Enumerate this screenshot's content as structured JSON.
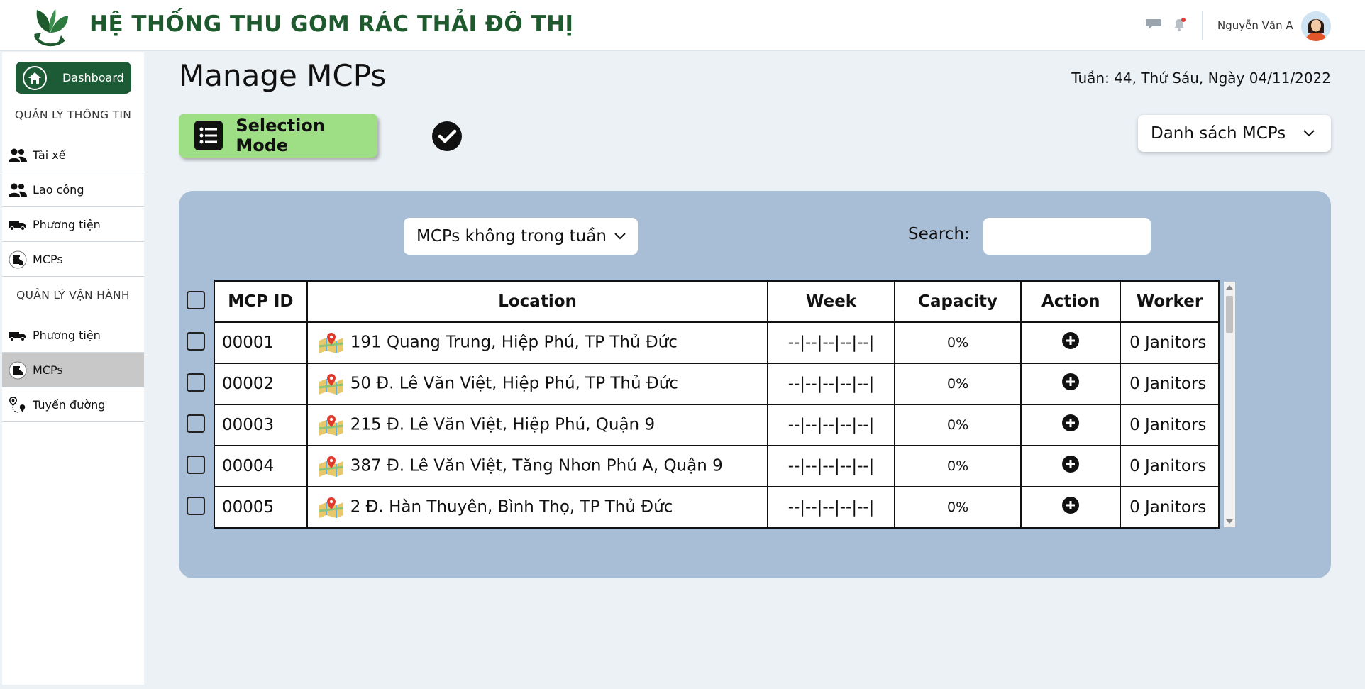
{
  "header": {
    "app_title": "HỆ THỐNG THU GOM RÁC THẢI ĐÔ THỊ",
    "user_name": "Nguyễn Văn A"
  },
  "sidebar": {
    "dashboard_label": "Dashboard",
    "section_info": "QUẢN LÝ THÔNG TIN",
    "info_items": [
      {
        "label": "Tài xế",
        "icon": "users-icon"
      },
      {
        "label": "Lao công",
        "icon": "users-icon"
      },
      {
        "label": "Phương tiện",
        "icon": "truck-icon"
      },
      {
        "label": "MCPs",
        "icon": "bin-icon"
      }
    ],
    "section_ops": "QUẢN LÝ VẬN HÀNH",
    "ops_items": [
      {
        "label": "Phương tiện",
        "icon": "truck-icon"
      },
      {
        "label": "MCPs",
        "icon": "bin-icon",
        "active": true
      },
      {
        "label": "Tuyến đường",
        "icon": "route-icon"
      }
    ]
  },
  "main": {
    "page_title": "Manage MCPs",
    "date_text": "Tuần: 44, Thứ Sáu, Ngày 04/11/2022",
    "selection_mode_label": "Selection Mode",
    "list_dropdown_label": "Danh sách MCPs",
    "filter_dropdown_label": "MCPs không trong tuần",
    "search_label": "Search:",
    "search_value": ""
  },
  "table": {
    "headers": [
      "MCP ID",
      "Location",
      "Week",
      "Capacity",
      "Action",
      "Worker"
    ],
    "rows": [
      {
        "id": "00001",
        "location": "191 Quang Trung, Hiệp Phú, TP Thủ Đức",
        "week": "--|--|--|--|--|",
        "capacity": "0%",
        "worker": "0 Janitors"
      },
      {
        "id": "00002",
        "location": "50 Đ. Lê Văn Việt, Hiệp Phú, TP Thủ Đức",
        "week": "--|--|--|--|--|",
        "capacity": "0%",
        "worker": "0 Janitors"
      },
      {
        "id": "00003",
        "location": "215 Đ. Lê Văn Việt, Hiệp Phú, Quận 9",
        "week": "--|--|--|--|--|",
        "capacity": "0%",
        "worker": "0 Janitors"
      },
      {
        "id": "00004",
        "location": "387 Đ. Lê Văn Việt, Tăng Nhơn Phú A, Quận 9",
        "week": "--|--|--|--|--|",
        "capacity": "0%",
        "worker": "0 Janitors"
      },
      {
        "id": "00005",
        "location": "2 Đ. Hàn Thuyên, Bình Thọ, TP Thủ Đức",
        "week": "--|--|--|--|--|",
        "capacity": "0%",
        "worker": "0 Janitors"
      }
    ]
  },
  "colors": {
    "brand_green": "#1d5a36",
    "title_green": "#1e5a2e",
    "selection_button": "#9ede84",
    "panel_blue": "#a8bdd6",
    "active_nav": "#c8c8c8"
  }
}
